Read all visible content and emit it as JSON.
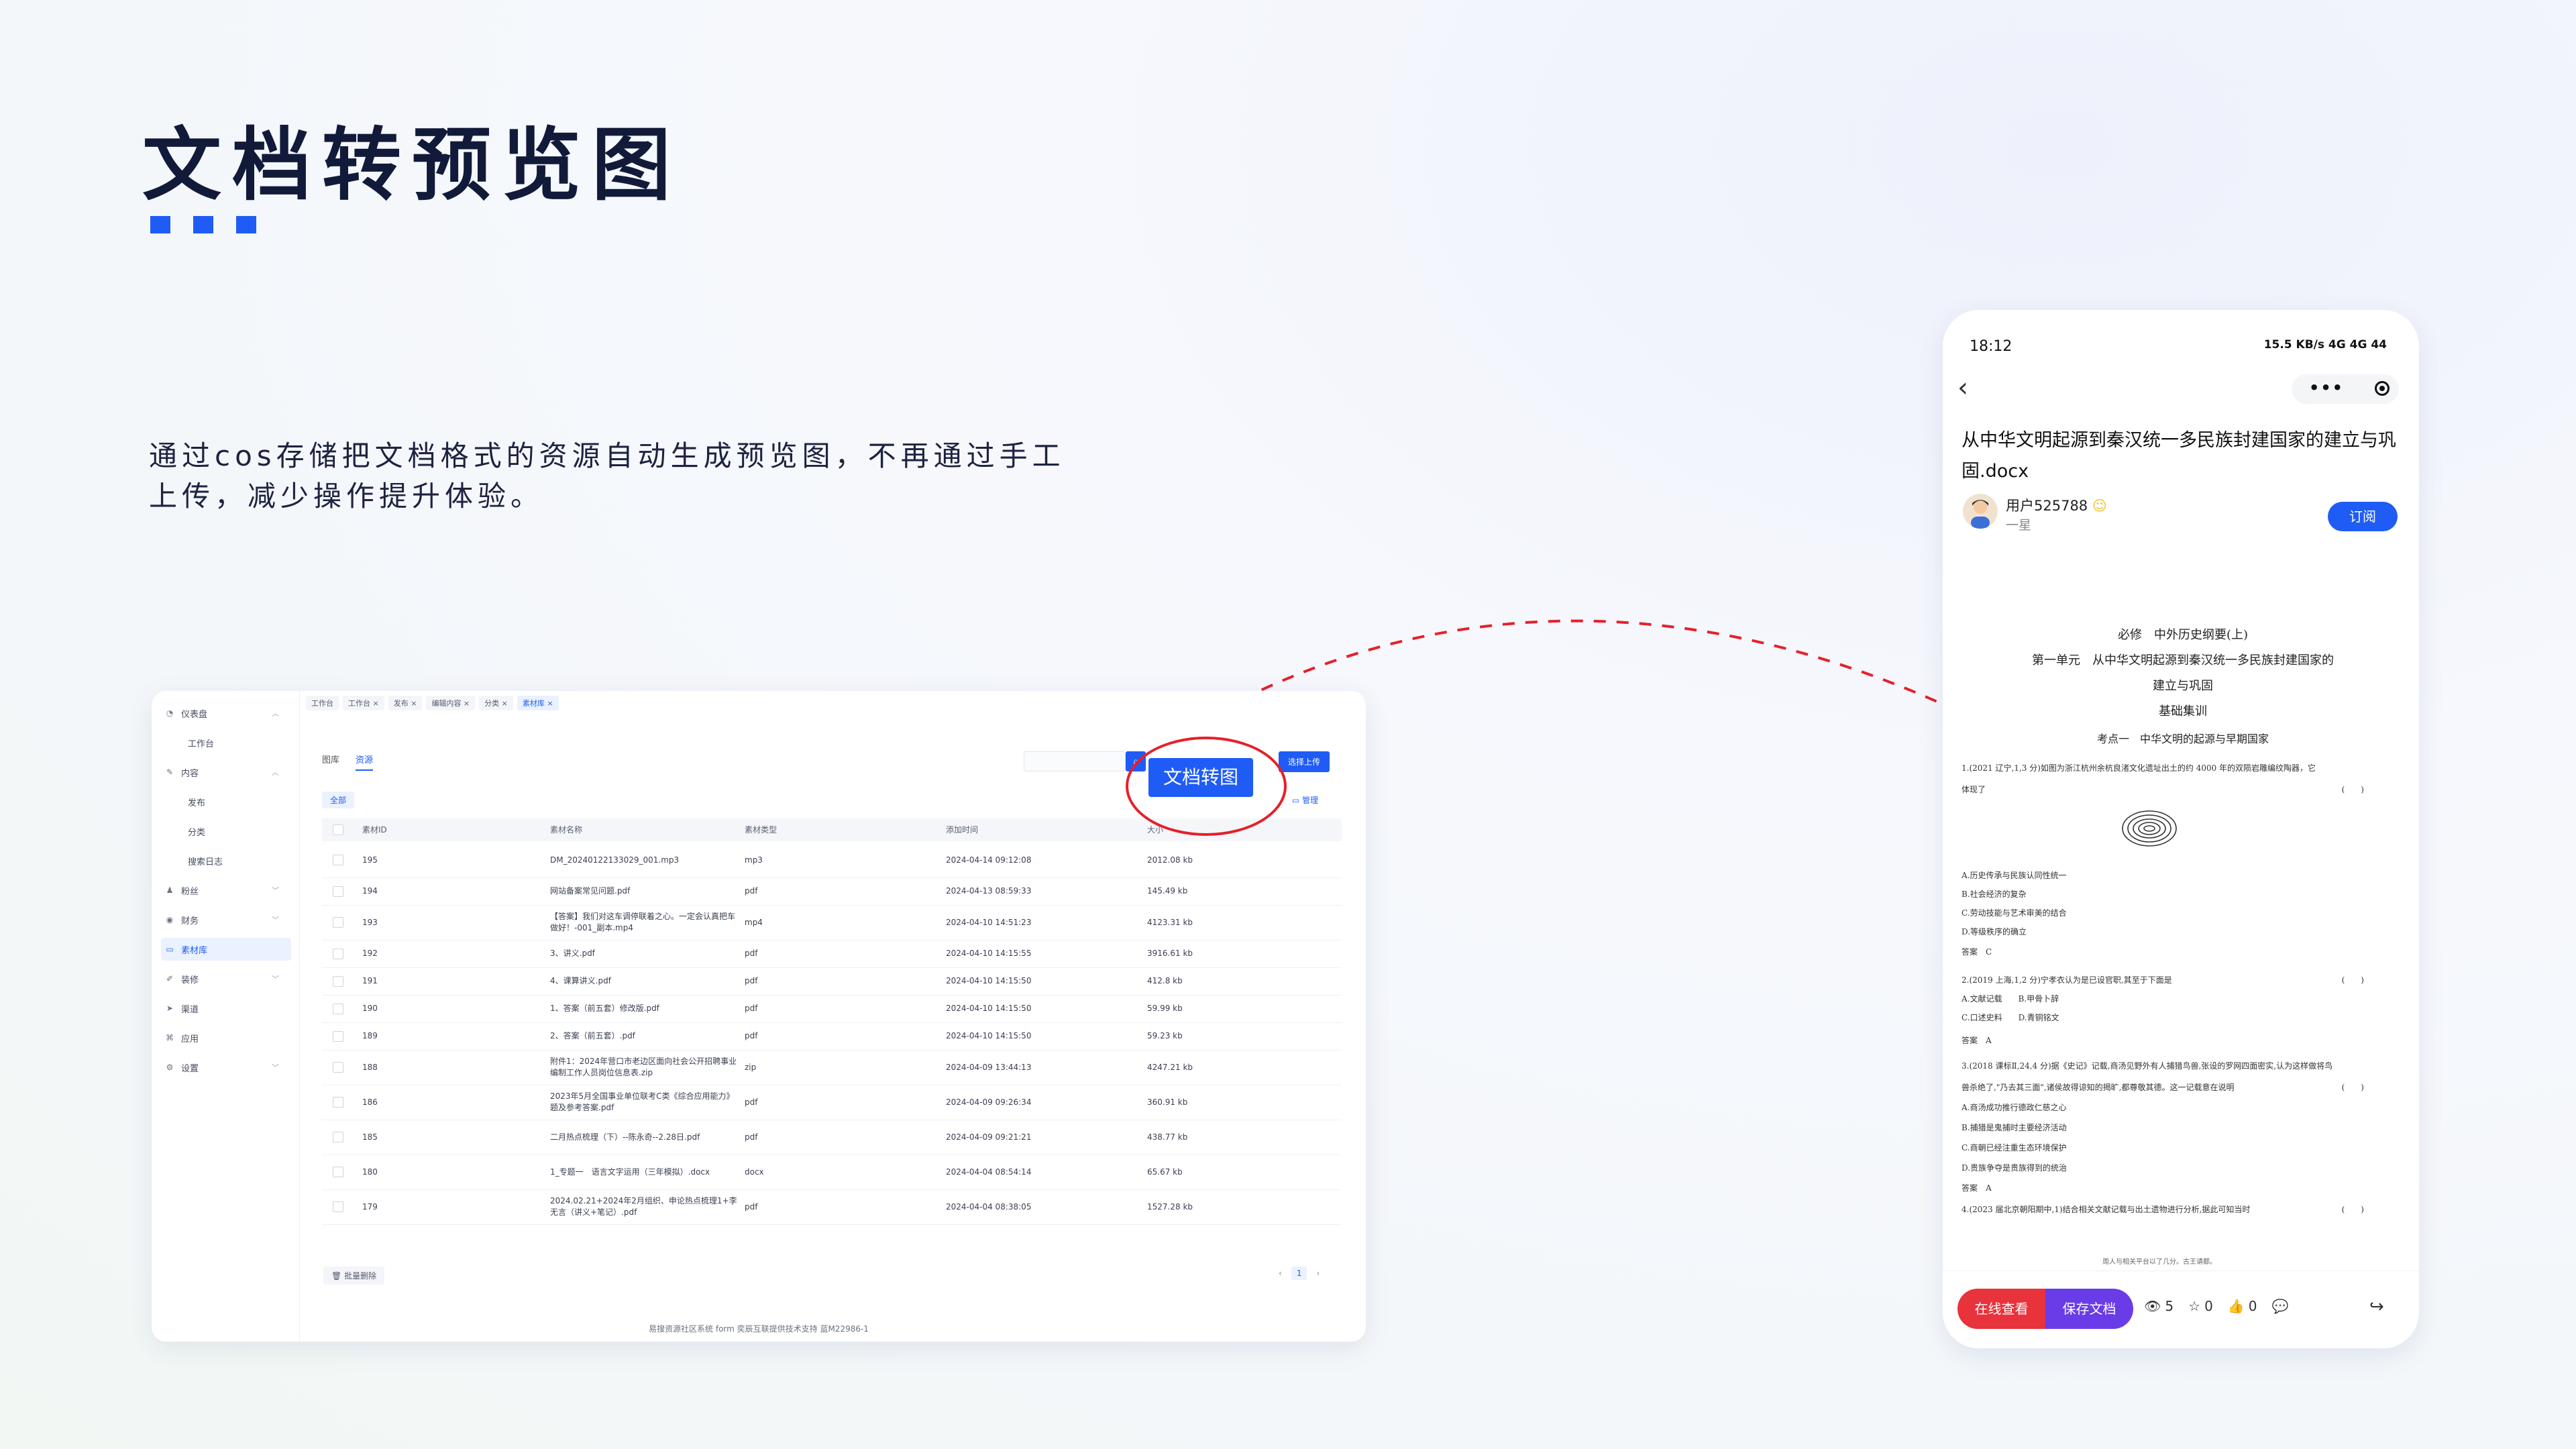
{
  "heading": {
    "title": "文档转预览图",
    "description": "通过cos存储把文档格式的资源自动生成预览图，不再通过手工上传，减少操作提升体验。"
  },
  "colors": {
    "accent": "#1f5cf5",
    "highlight": "#e6202a"
  },
  "admin": {
    "sidebar": [
      {
        "label": "仪表盘",
        "icon": "dashboard-icon",
        "expanded": true
      },
      {
        "label": "工作台",
        "sub": true
      },
      {
        "label": "内容",
        "icon": "edit-icon",
        "expanded": true
      },
      {
        "label": "发布",
        "sub": true
      },
      {
        "label": "分类",
        "sub": true
      },
      {
        "label": "搜索日志",
        "sub": true
      },
      {
        "label": "粉丝",
        "icon": "user-icon",
        "expanded": false
      },
      {
        "label": "财务",
        "icon": "wallet-icon",
        "expanded": false
      },
      {
        "label": "素材库",
        "icon": "folder-icon",
        "active": true
      },
      {
        "label": "装修",
        "icon": "brush-icon",
        "expanded": false
      },
      {
        "label": "渠道",
        "icon": "send-icon"
      },
      {
        "label": "应用",
        "icon": "apps-icon"
      },
      {
        "label": "设置",
        "icon": "gear-icon",
        "expanded": false
      }
    ],
    "tabs": [
      "工作台",
      "工作台 ×",
      "发布 ×",
      "编辑内容 ×",
      "分类 ×",
      "素材库 ×"
    ],
    "subtabs": [
      "图库",
      "资源"
    ],
    "filter_all": "全部",
    "upload_label": "选择上传",
    "manage_label": "管理",
    "convert_label": "文档转图",
    "columns": [
      "素材ID",
      "素材名称",
      "素材类型",
      "添加时间",
      "大小"
    ],
    "rows": [
      {
        "id": "195",
        "name": "DM_20240122133029_001.mp3",
        "type": "mp3",
        "time": "2024-04-14 09:12:08",
        "size": "2012.08 kb"
      },
      {
        "id": "194",
        "name": "网站备案常见问题.pdf",
        "type": "pdf",
        "time": "2024-04-13 08:59:33",
        "size": "145.49 kb"
      },
      {
        "id": "193",
        "name": "【答案】我们对这车调停联着之心。一定会认真把车做好！-001_副本.mp4",
        "type": "mp4",
        "time": "2024-04-10 14:51:23",
        "size": "4123.31 kb"
      },
      {
        "id": "192",
        "name": "3、讲义.pdf",
        "type": "pdf",
        "time": "2024-04-10 14:15:55",
        "size": "3916.61 kb"
      },
      {
        "id": "191",
        "name": "4、课算讲义.pdf",
        "type": "pdf",
        "time": "2024-04-10 14:15:50",
        "size": "412.8 kb"
      },
      {
        "id": "190",
        "name": "1、答案（前五套）修改版.pdf",
        "type": "pdf",
        "time": "2024-04-10 14:15:50",
        "size": "59.99 kb"
      },
      {
        "id": "189",
        "name": "2、答案（前五套）.pdf",
        "type": "pdf",
        "time": "2024-04-10 14:15:50",
        "size": "59.23 kb"
      },
      {
        "id": "188",
        "name": "附件1：2024年营口市老边区面向社会公开招聘事业编制工作人员岗位信息表.zip",
        "type": "zip",
        "time": "2024-04-09 13:44:13",
        "size": "4247.21 kb"
      },
      {
        "id": "186",
        "name": "2023年5月全国事业单位联考C类《综合应用能力》题及参考答案.pdf",
        "type": "pdf",
        "time": "2024-04-09 09:26:34",
        "size": "360.91 kb"
      },
      {
        "id": "185",
        "name": "二月热点梳理（下）--陈永奇--2.28日.pdf",
        "type": "pdf",
        "time": "2024-04-09 09:21:21",
        "size": "438.77 kb"
      },
      {
        "id": "180",
        "name": "1_专题一　语言文字运用（三年模拟）.docx",
        "type": "docx",
        "time": "2024-04-04 08:54:14",
        "size": "65.67 kb"
      },
      {
        "id": "179",
        "name": "2024.02.21+2024年2月组织、申论热点梳理1+李无言（讲义+笔记）.pdf",
        "type": "pdf",
        "time": "2024-04-04 08:38:05",
        "size": "1527.28 kb"
      }
    ],
    "batch_delete": "批量删除",
    "page": "1",
    "footer": "易搜资源社区系统 form 奕辰互联提供技术支持 蓝M22986-1"
  },
  "phone": {
    "time": "18:12",
    "status": "15.5 KB/s 4G 4G 44",
    "doc_title": "从中华文明起源到秦汉统一多民族封建国家的建立与巩固.docx",
    "user_name": "用户525788",
    "user_level": "一星",
    "subscribe": "订阅",
    "doc": {
      "h1": "必修　中外历史纲要(上)",
      "h2": "第一单元　从中华文明起源到秦汉统一多民族封建国家的",
      "h3": "建立与巩固",
      "h4": "基础集训",
      "h5": "考点一　中华文明的起源与早期国家",
      "q1a": "1.(2021 辽宁,1,3 分)如图为浙江杭州余杭良渚文化遗址出土的约 4000 年的双陨岩雕编纹陶器，它",
      "q1b": "体现了",
      "opts1": [
        "A.历史传承与民族认同性统一",
        "B.社会经济的复杂",
        "C.劳动技能与艺术审美的结合",
        "D.等级秩序的确立"
      ],
      "ans1": "答案　C",
      "q2": "2.(2019 上海,1,2 分)宁孝衣认为是已设官职,其至于下面是",
      "opts2": [
        "A.文献记载　　B.甲骨卜辞",
        "C.口述史料　　D.青铜铭文"
      ],
      "ans2": "答案　A",
      "q3a": "3.(2018 课标Ⅱ,24,4 分)据《史记》记载,商汤见野外有人捕猎鸟兽,张设的罗网四面密实,认为这样做将鸟",
      "q3b": "兽杀绝了,\"乃去其三面\",诸侯故得谅知的揭旷,都尊敬其德。这一记载意在说明",
      "opts3": [
        "A.商汤成功推行德政仁慈之心",
        "B.捕猎是鬼捕时主要经济活动",
        "C.商朝已经注重生态环境保护",
        "D.贵族争夺是贵族得到的统治"
      ],
      "ans3": "答案　A",
      "q4": "4.(2023 届北京朝阳期中,1)结合相关文献记载与出土遗物进行分析,据此可知当时",
      "bottom": "周人与相关平台以了几分。古王请都。"
    },
    "btn_view": "在线查看",
    "btn_save": "保存文档",
    "views": "5",
    "stars": "0",
    "likes": "0"
  }
}
